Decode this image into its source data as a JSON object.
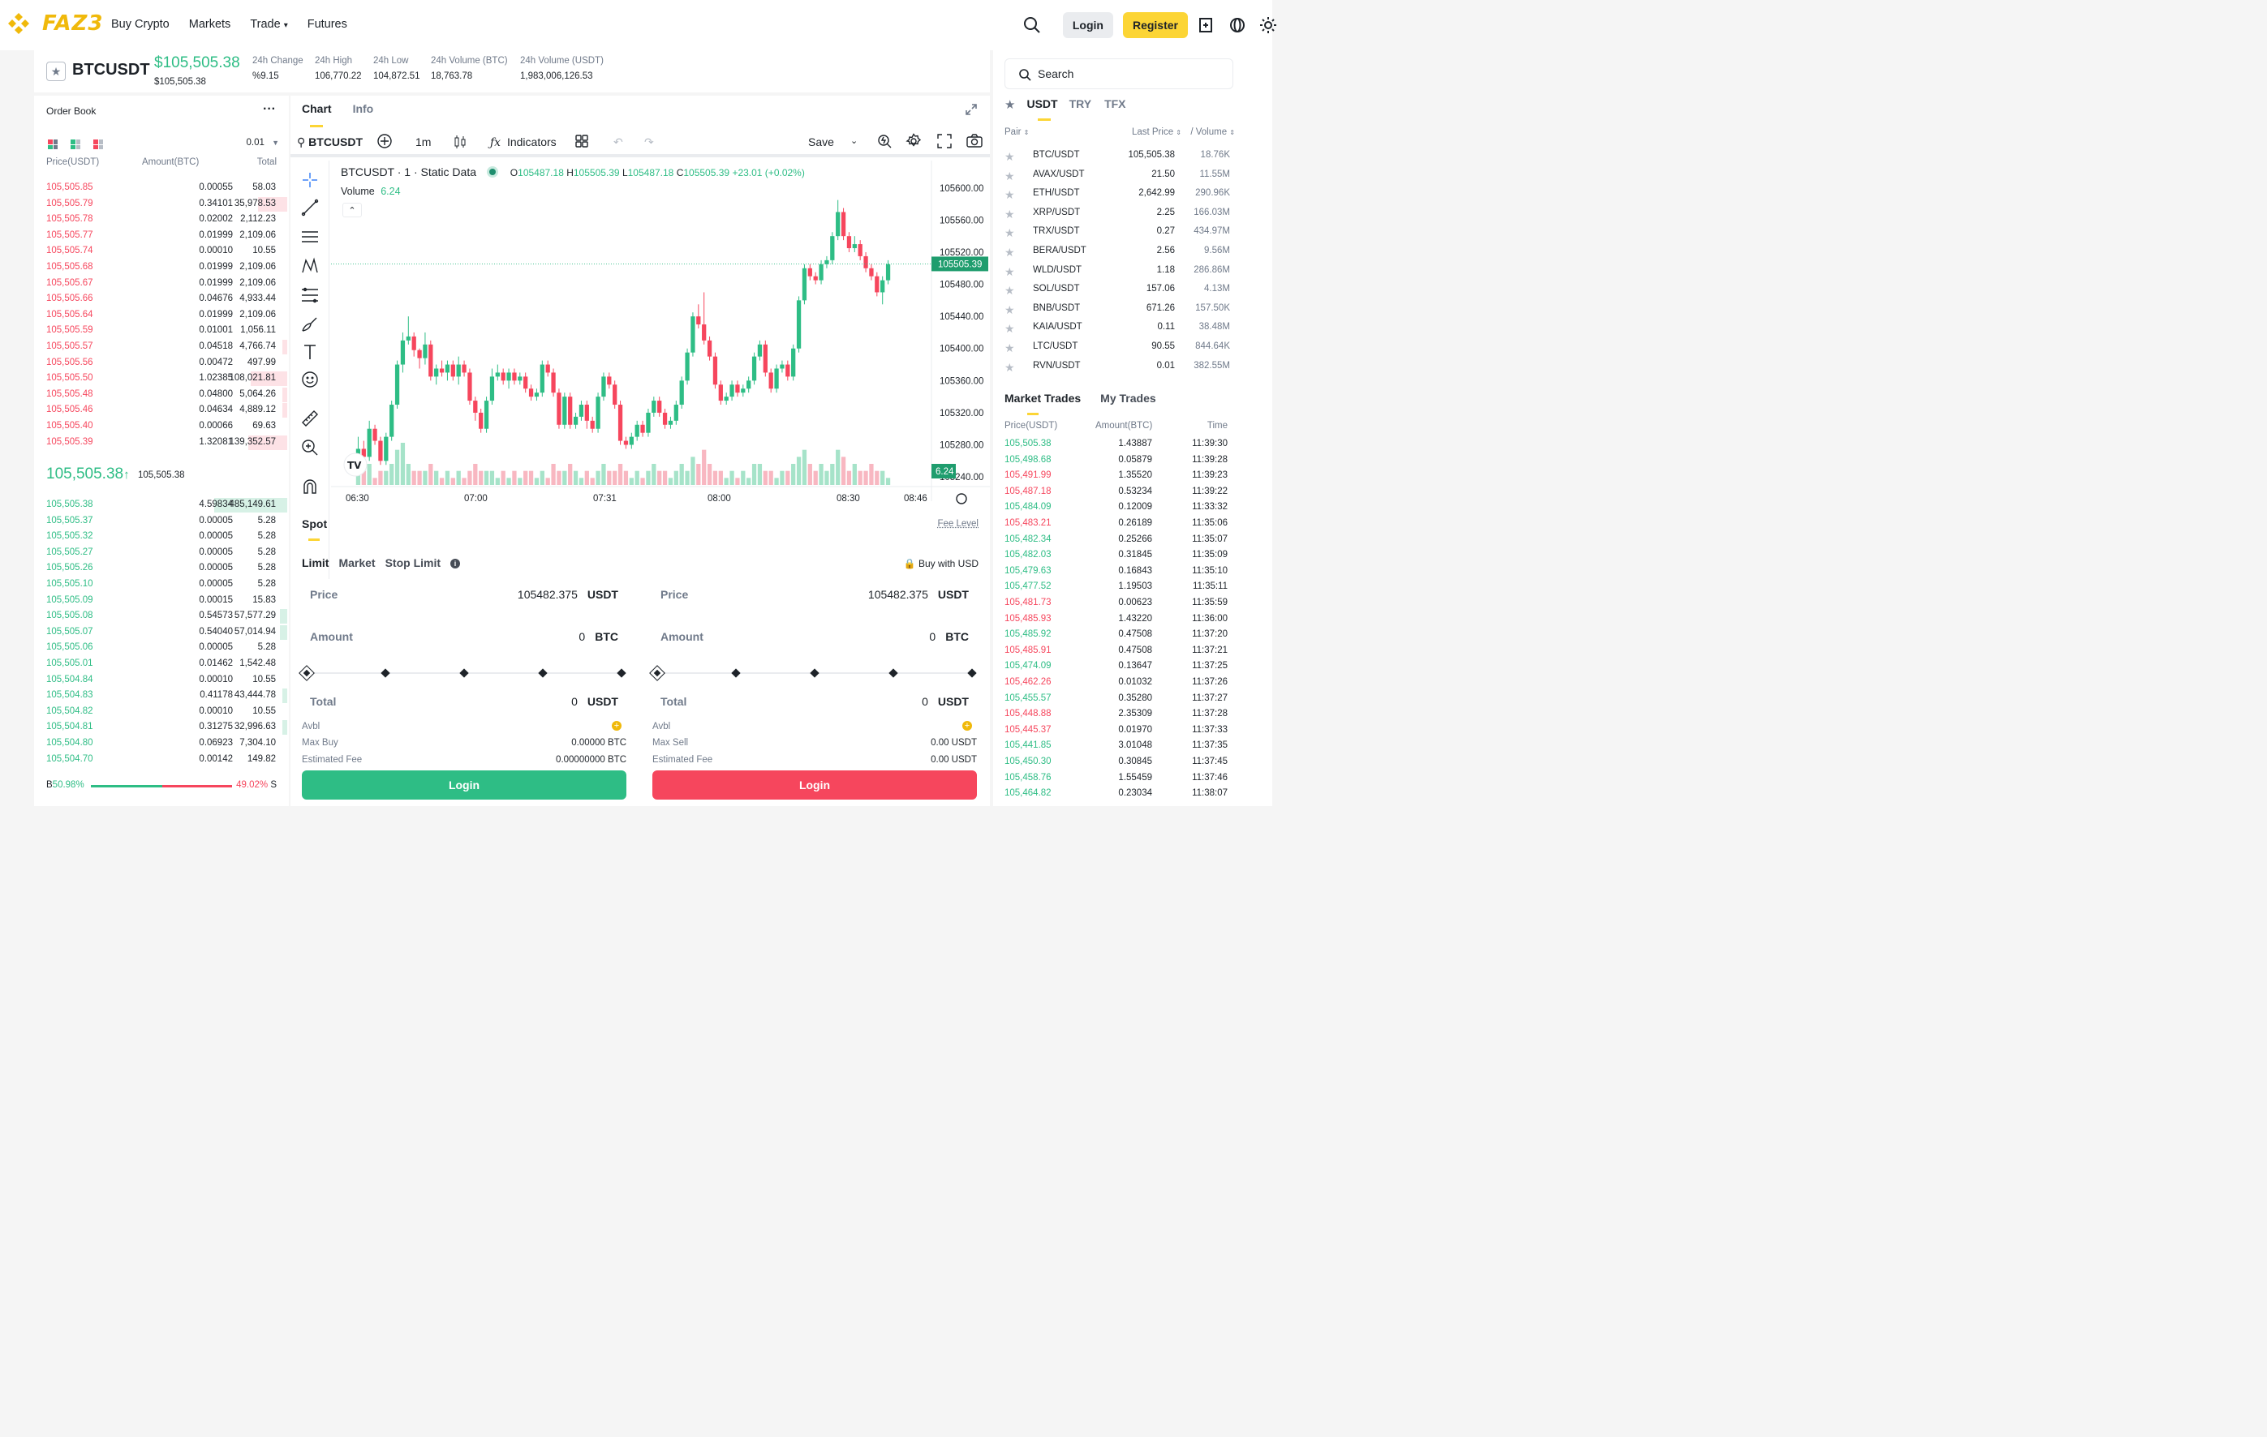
{
  "header": {
    "logo_text": "FAZ3",
    "nav": [
      "Buy Crypto",
      "Markets",
      "Trade",
      "Futures"
    ],
    "login": "Login",
    "register": "Register",
    "accent": "#fcd535"
  },
  "ticker": {
    "symbol": "BTCUSDT",
    "last_price": "$105,505.38",
    "last_price_sub": "$105,505.38",
    "stats": [
      {
        "label": "24h Change",
        "value": "%9.15",
        "color": "green"
      },
      {
        "label": "24h High",
        "value": "106,770.22"
      },
      {
        "label": "24h Low",
        "value": "104,872.51"
      },
      {
        "label": "24h Volume (BTC)",
        "value": "18,763.78"
      },
      {
        "label": "24h Volume (USDT)",
        "value": "1,983,006,126.53"
      }
    ]
  },
  "orderbook": {
    "title": "Order Book",
    "precision": "0.01",
    "headers": [
      "Price(USDT)",
      "Amount(BTC)",
      "Total"
    ],
    "asks": [
      [
        "105,505.85",
        "0.00055",
        "58.03",
        0
      ],
      [
        "105,505.79",
        "0.34101",
        "35,978.53",
        0.12
      ],
      [
        "105,505.78",
        "0.02002",
        "2,112.23",
        0
      ],
      [
        "105,505.77",
        "0.01999",
        "2,109.06",
        0
      ],
      [
        "105,505.74",
        "0.00010",
        "10.55",
        0
      ],
      [
        "105,505.68",
        "0.01999",
        "2,109.06",
        0
      ],
      [
        "105,505.67",
        "0.01999",
        "2,109.06",
        0
      ],
      [
        "105,505.66",
        "0.04676",
        "4,933.44",
        0
      ],
      [
        "105,505.64",
        "0.01999",
        "2,109.06",
        0
      ],
      [
        "105,505.59",
        "0.01001",
        "1,056.11",
        0
      ],
      [
        "105,505.57",
        "0.04518",
        "4,766.74",
        0.02
      ],
      [
        "105,505.56",
        "0.00472",
        "497.99",
        0
      ],
      [
        "105,505.50",
        "1.02385",
        "108,021.81",
        0.15
      ],
      [
        "105,505.48",
        "0.04800",
        "5,064.26",
        0.02
      ],
      [
        "105,505.46",
        "0.04634",
        "4,889.12",
        0.02
      ],
      [
        "105,505.40",
        "0.00066",
        "69.63",
        0
      ],
      [
        "105,505.39",
        "1.32081",
        "139,352.57",
        0.16
      ]
    ],
    "mid_price": "105,505.38",
    "mid_price_sub": "105,505.38",
    "bids": [
      [
        "105,505.38",
        "4.59834",
        "485,149.61",
        0.29
      ],
      [
        "105,505.37",
        "0.00005",
        "5.28",
        0
      ],
      [
        "105,505.32",
        "0.00005",
        "5.28",
        0
      ],
      [
        "105,505.27",
        "0.00005",
        "5.28",
        0
      ],
      [
        "105,505.26",
        "0.00005",
        "5.28",
        0
      ],
      [
        "105,505.10",
        "0.00005",
        "5.28",
        0
      ],
      [
        "105,505.09",
        "0.00015",
        "15.83",
        0
      ],
      [
        "105,505.08",
        "0.54573",
        "57,577.29",
        0.03
      ],
      [
        "105,505.07",
        "0.54040",
        "57,014.94",
        0.03
      ],
      [
        "105,505.06",
        "0.00005",
        "5.28",
        0
      ],
      [
        "105,505.01",
        "0.01462",
        "1,542.48",
        0
      ],
      [
        "105,504.84",
        "0.00010",
        "10.55",
        0
      ],
      [
        "105,504.83",
        "0.41178",
        "43,444.78",
        0.02
      ],
      [
        "105,504.82",
        "0.00010",
        "10.55",
        0
      ],
      [
        "105,504.81",
        "0.31275",
        "32,996.63",
        0.02
      ],
      [
        "105,504.80",
        "0.06923",
        "7,304.10",
        0
      ],
      [
        "105,504.70",
        "0.00142",
        "149.82",
        0
      ]
    ],
    "buy_ratio": "50.98%",
    "sell_ratio": "49.02%",
    "buy_label": "B",
    "sell_label": "S"
  },
  "center": {
    "tabs": [
      "Chart",
      "Info"
    ],
    "toolbar": {
      "symbol": "BTCUSDT",
      "interval": "1m",
      "indicators": "Indicators",
      "save": "Save"
    },
    "legend": {
      "title": "BTCUSDT · 1 · Static Data",
      "o": "105487.18",
      "h": "105505.39",
      "l": "105487.18",
      "c": "105505.39",
      "chg": "+23.01 (+0.02%)",
      "volume_label": "Volume",
      "volume_value": "6.24"
    },
    "spot_title": "Spot",
    "fee_level": "Fee Level",
    "order_types": [
      "Limit",
      "Market",
      "Stop Limit"
    ],
    "buy_with_usd": "Buy with USD",
    "buy": {
      "price_label": "Price",
      "price": "105482.375",
      "price_unit": "USDT",
      "amount_label": "Amount",
      "amount": "0",
      "amount_unit": "BTC",
      "total_label": "Total",
      "total": "0",
      "total_unit": "USDT",
      "avbl": "Avbl",
      "max_label": "Max Buy",
      "max_value": "0.00000 BTC",
      "fee_label": "Estimated Fee",
      "fee_value": "0.00000000 BTC",
      "button": "Login"
    },
    "sell": {
      "price_label": "Price",
      "price": "105482.375",
      "price_unit": "USDT",
      "amount_label": "Amount",
      "amount": "0",
      "amount_unit": "BTC",
      "total_label": "Total",
      "total": "0",
      "total_unit": "USDT",
      "avbl": "Avbl",
      "max_label": "Max Sell",
      "max_value": "0.00 USDT",
      "fee_label": "Estimated Fee",
      "fee_value": "0.00 USDT",
      "button": "Login"
    }
  },
  "chart_data": {
    "type": "candlestick",
    "x_ticks": [
      "06:30",
      "07:00",
      "07:31",
      "08:00",
      "08:30",
      "08:46"
    ],
    "y_ticks": [
      "105600.00",
      "105560.00",
      "105520.00",
      "105480.00",
      "105440.00",
      "105400.00",
      "105360.00",
      "105320.00",
      "105280.00",
      "105240.00"
    ],
    "ylim": [
      105230,
      105620
    ],
    "last_price_label": "105505.39",
    "last_volume_label": "6.24",
    "candles": [
      [
        105250,
        105275,
        105290,
        105245
      ],
      [
        105275,
        105265,
        105285,
        105250
      ],
      [
        105265,
        105300,
        105310,
        105260
      ],
      [
        105300,
        105285,
        105305,
        105280
      ],
      [
        105285,
        105260,
        105290,
        105255
      ],
      [
        105260,
        105290,
        105295,
        105255
      ],
      [
        105290,
        105330,
        105335,
        105285
      ],
      [
        105330,
        105380,
        105385,
        105325
      ],
      [
        105380,
        105410,
        105420,
        105370
      ],
      [
        105410,
        105415,
        105440,
        105405
      ],
      [
        105415,
        105398,
        105420,
        105390
      ],
      [
        105398,
        105388,
        105400,
        105375
      ],
      [
        105388,
        105405,
        105420,
        105380
      ],
      [
        105405,
        105365,
        105410,
        105360
      ],
      [
        105365,
        105375,
        105380,
        105355
      ],
      [
        105375,
        105370,
        105385,
        105365
      ],
      [
        105370,
        105380,
        105385,
        105360
      ],
      [
        105380,
        105365,
        105385,
        105360
      ],
      [
        105365,
        105380,
        105390,
        105355
      ],
      [
        105380,
        105370,
        105385,
        105365
      ],
      [
        105370,
        105335,
        105375,
        105330
      ],
      [
        105335,
        105320,
        105340,
        105310
      ],
      [
        105320,
        105300,
        105325,
        105295
      ],
      [
        105300,
        105335,
        105340,
        105295
      ],
      [
        105335,
        105365,
        105375,
        105330
      ],
      [
        105365,
        105370,
        105380,
        105360
      ],
      [
        105370,
        105360,
        105375,
        105355
      ],
      [
        105360,
        105370,
        105375,
        105350
      ],
      [
        105370,
        105360,
        105375,
        105355
      ],
      [
        105360,
        105365,
        105370,
        105355
      ],
      [
        105365,
        105350,
        105370,
        105345
      ],
      [
        105350,
        105340,
        105355,
        105335
      ],
      [
        105340,
        105345,
        105350,
        105335
      ],
      [
        105345,
        105380,
        105385,
        105340
      ],
      [
        105380,
        105370,
        105385,
        105365
      ],
      [
        105370,
        105345,
        105375,
        105340
      ],
      [
        105345,
        105305,
        105350,
        105300
      ],
      [
        105305,
        105340,
        105345,
        105300
      ],
      [
        105340,
        105305,
        105345,
        105300
      ],
      [
        105305,
        105315,
        105320,
        105300
      ],
      [
        105315,
        105330,
        105335,
        105310
      ],
      [
        105330,
        105310,
        105335,
        105300
      ],
      [
        105310,
        105300,
        105315,
        105295
      ],
      [
        105300,
        105340,
        105345,
        105295
      ],
      [
        105340,
        105365,
        105370,
        105335
      ],
      [
        105365,
        105355,
        105370,
        105350
      ],
      [
        105355,
        105330,
        105360,
        105325
      ],
      [
        105330,
        105285,
        105335,
        105280
      ],
      [
        105285,
        105280,
        105290,
        105275
      ],
      [
        105280,
        105290,
        105295,
        105275
      ],
      [
        105290,
        105305,
        105310,
        105285
      ],
      [
        105305,
        105295,
        105310,
        105290
      ],
      [
        105295,
        105320,
        105325,
        105290
      ],
      [
        105320,
        105335,
        105340,
        105315
      ],
      [
        105335,
        105320,
        105340,
        105315
      ],
      [
        105320,
        105305,
        105325,
        105300
      ],
      [
        105305,
        105310,
        105315,
        105300
      ],
      [
        105310,
        105330,
        105335,
        105305
      ],
      [
        105330,
        105360,
        105365,
        105325
      ],
      [
        105360,
        105395,
        105400,
        105355
      ],
      [
        105395,
        105440,
        105445,
        105390
      ],
      [
        105440,
        105430,
        105455,
        105425
      ],
      [
        105430,
        105410,
        105470,
        105405
      ],
      [
        105410,
        105390,
        105415,
        105385
      ],
      [
        105390,
        105355,
        105395,
        105350
      ],
      [
        105355,
        105335,
        105360,
        105330
      ],
      [
        105335,
        105340,
        105345,
        105330
      ],
      [
        105340,
        105355,
        105360,
        105335
      ],
      [
        105355,
        105345,
        105360,
        105340
      ],
      [
        105345,
        105350,
        105355,
        105340
      ],
      [
        105350,
        105360,
        105365,
        105345
      ],
      [
        105360,
        105390,
        105395,
        105355
      ],
      [
        105390,
        105405,
        105410,
        105385
      ],
      [
        105405,
        105370,
        105410,
        105365
      ],
      [
        105370,
        105350,
        105375,
        105345
      ],
      [
        105350,
        105375,
        105380,
        105345
      ],
      [
        105375,
        105380,
        105385,
        105370
      ],
      [
        105380,
        105365,
        105385,
        105360
      ],
      [
        105365,
        105400,
        105405,
        105360
      ],
      [
        105400,
        105460,
        105465,
        105395
      ],
      [
        105460,
        105500,
        105505,
        105455
      ],
      [
        105500,
        105490,
        105505,
        105485
      ],
      [
        105490,
        105485,
        105495,
        105480
      ],
      [
        105485,
        105505,
        105510,
        105480
      ],
      [
        105505,
        105510,
        105515,
        105500
      ],
      [
        105510,
        105540,
        105545,
        105505
      ],
      [
        105540,
        105570,
        105585,
        105535
      ],
      [
        105570,
        105540,
        105575,
        105535
      ],
      [
        105540,
        105525,
        105545,
        105520
      ],
      [
        105525,
        105530,
        105540,
        105520
      ],
      [
        105530,
        105515,
        105535,
        105510
      ],
      [
        105515,
        105500,
        105520,
        105495
      ],
      [
        105500,
        105490,
        105505,
        105485
      ],
      [
        105490,
        105470,
        105495,
        105465
      ],
      [
        105470,
        105485,
        105490,
        105455
      ],
      [
        105485,
        105505,
        105510,
        105480
      ]
    ],
    "volumes": [
      3,
      2,
      3,
      1,
      2,
      2,
      3,
      5,
      6,
      3,
      2,
      2,
      2,
      3,
      2,
      1,
      2,
      1,
      2,
      1,
      2,
      3,
      2,
      2,
      2,
      1,
      2,
      1,
      2,
      1,
      2,
      2,
      1,
      2,
      1,
      3,
      2,
      2,
      3,
      2,
      1,
      2,
      1,
      2,
      3,
      2,
      2,
      3,
      2,
      1,
      2,
      1,
      2,
      3,
      2,
      2,
      1,
      2,
      3,
      2,
      4,
      3,
      5,
      3,
      2,
      2,
      1,
      2,
      1,
      2,
      1,
      3,
      3,
      2,
      2,
      1,
      2,
      2,
      3,
      4,
      5,
      3,
      2,
      3,
      2,
      3,
      5,
      4,
      2,
      3,
      2,
      2,
      3,
      2,
      2,
      1
    ]
  },
  "markets": {
    "search_placeholder": "Search",
    "tabs": [
      "USDT",
      "TRY",
      "TFX"
    ],
    "headers": [
      "Pair",
      "Last Price",
      "/ Volume"
    ],
    "pairs": [
      [
        "BTC/USDT",
        "105,505.38",
        "18.76K"
      ],
      [
        "AVAX/USDT",
        "21.50",
        "11.55M"
      ],
      [
        "ETH/USDT",
        "2,642.99",
        "290.96K"
      ],
      [
        "XRP/USDT",
        "2.25",
        "166.03M"
      ],
      [
        "TRX/USDT",
        "0.27",
        "434.97M"
      ],
      [
        "BERA/USDT",
        "2.56",
        "9.56M"
      ],
      [
        "WLD/USDT",
        "1.18",
        "286.86M"
      ],
      [
        "SOL/USDT",
        "157.06",
        "4.13M"
      ],
      [
        "BNB/USDT",
        "671.26",
        "157.50K"
      ],
      [
        "KAIA/USDT",
        "0.11",
        "38.48M"
      ],
      [
        "LTC/USDT",
        "90.55",
        "844.64K"
      ],
      [
        "RVN/USDT",
        "0.01",
        "382.55M"
      ]
    ]
  },
  "trades": {
    "tabs": [
      "Market Trades",
      "My Trades"
    ],
    "headers": [
      "Price(USDT)",
      "Amount(BTC)",
      "Time"
    ],
    "rows": [
      [
        "105,505.38",
        "1.43887",
        "11:39:30",
        "g"
      ],
      [
        "105,498.68",
        "0.05879",
        "11:39:28",
        "g"
      ],
      [
        "105,491.99",
        "1.35520",
        "11:39:23",
        "r"
      ],
      [
        "105,487.18",
        "0.53234",
        "11:39:22",
        "r"
      ],
      [
        "105,484.09",
        "0.12009",
        "11:33:32",
        "g"
      ],
      [
        "105,483.21",
        "0.26189",
        "11:35:06",
        "r"
      ],
      [
        "105,482.34",
        "0.25266",
        "11:35:07",
        "g"
      ],
      [
        "105,482.03",
        "0.31845",
        "11:35:09",
        "g"
      ],
      [
        "105,479.63",
        "0.16843",
        "11:35:10",
        "g"
      ],
      [
        "105,477.52",
        "1.19503",
        "11:35:11",
        "g"
      ],
      [
        "105,481.73",
        "0.00623",
        "11:35:59",
        "r"
      ],
      [
        "105,485.93",
        "1.43220",
        "11:36:00",
        "r"
      ],
      [
        "105,485.92",
        "0.47508",
        "11:37:20",
        "g"
      ],
      [
        "105,485.91",
        "0.47508",
        "11:37:21",
        "r"
      ],
      [
        "105,474.09",
        "0.13647",
        "11:37:25",
        "g"
      ],
      [
        "105,462.26",
        "0.01032",
        "11:37:26",
        "r"
      ],
      [
        "105,455.57",
        "0.35280",
        "11:37:27",
        "g"
      ],
      [
        "105,448.88",
        "2.35309",
        "11:37:28",
        "r"
      ],
      [
        "105,445.37",
        "0.01970",
        "11:37:33",
        "r"
      ],
      [
        "105,441.85",
        "3.01048",
        "11:37:35",
        "g"
      ],
      [
        "105,450.30",
        "0.30845",
        "11:37:45",
        "g"
      ],
      [
        "105,458.76",
        "1.55459",
        "11:37:46",
        "g"
      ],
      [
        "105,464.82",
        "0.23034",
        "11:38:07",
        "g"
      ]
    ]
  }
}
